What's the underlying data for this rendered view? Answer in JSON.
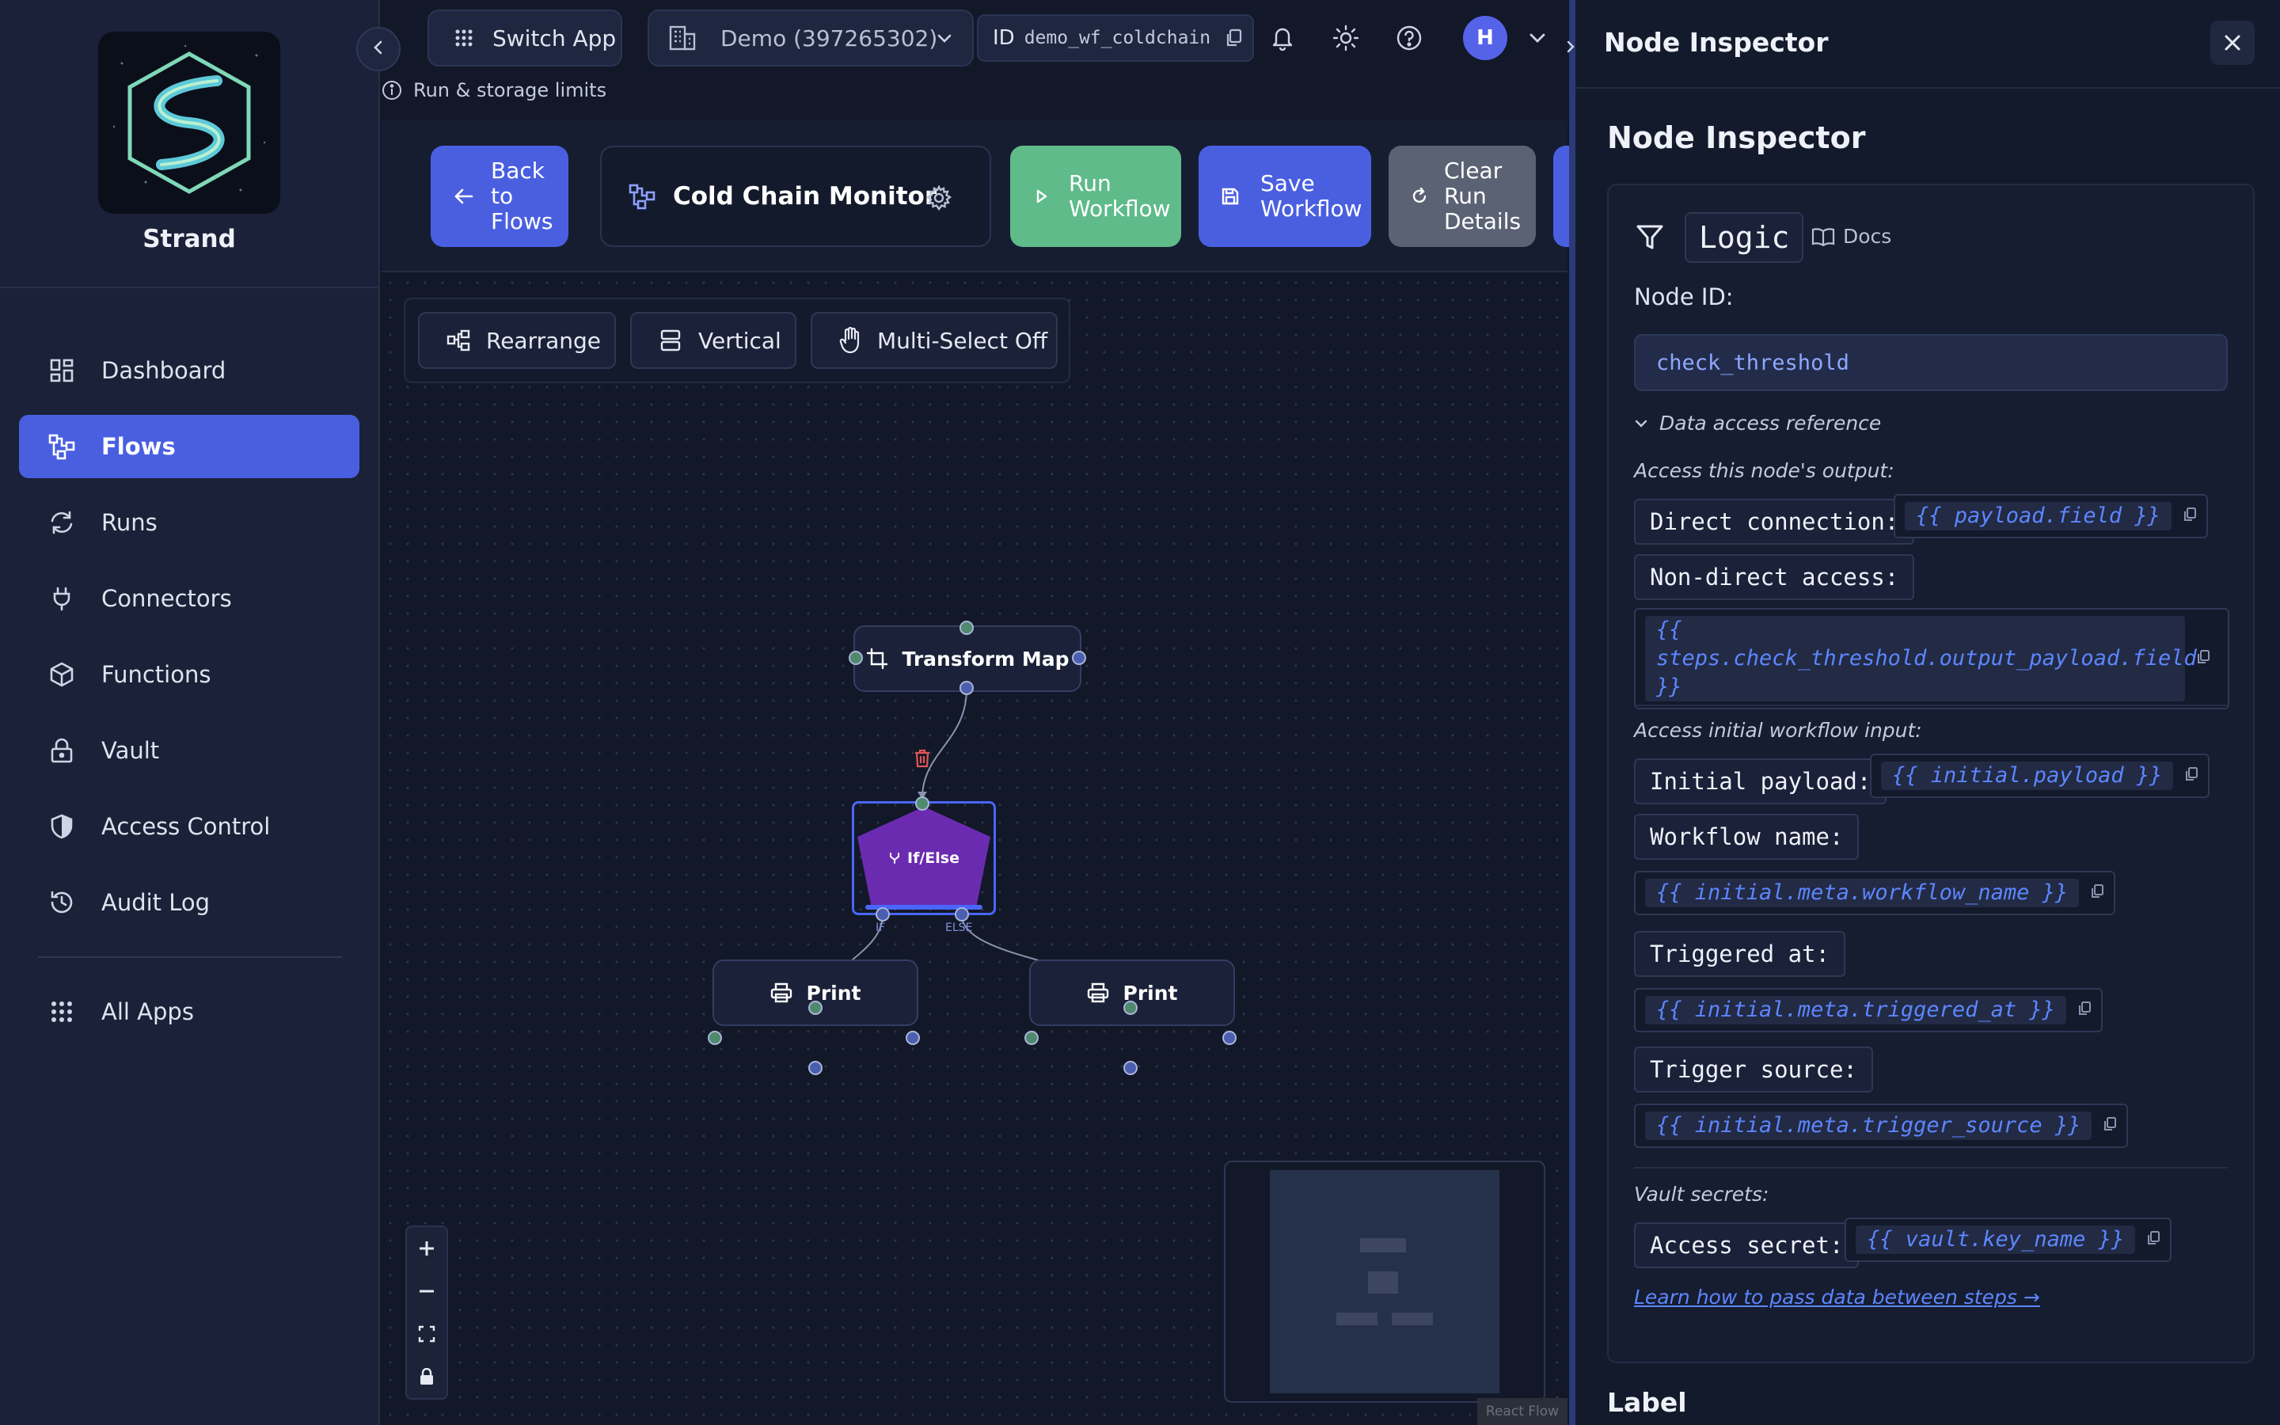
{
  "brand": {
    "name": "Strand"
  },
  "nav": {
    "items": [
      {
        "label": "Dashboard",
        "icon": "dashboard-icon"
      },
      {
        "label": "Flows",
        "icon": "flows-icon",
        "active": true
      },
      {
        "label": "Runs",
        "icon": "runs-icon"
      },
      {
        "label": "Connectors",
        "icon": "plug-icon"
      },
      {
        "label": "Functions",
        "icon": "cube-icon"
      },
      {
        "label": "Vault",
        "icon": "lock-icon"
      },
      {
        "label": "Access Control",
        "icon": "shield-icon"
      },
      {
        "label": "Audit Log",
        "icon": "history-icon"
      }
    ],
    "all_apps": "All Apps"
  },
  "topbar": {
    "switch_app": "Switch App",
    "org": "Demo (397265302)",
    "id_prefix": "ID",
    "workflow_id": "demo_wf_coldchain",
    "avatar_initial": "H",
    "limits": "Run & storage limits"
  },
  "toolbar": {
    "back": [
      "Back",
      "to",
      "Flows"
    ],
    "flow_title": "Cold Chain Monitor",
    "run": [
      "Run",
      "Workflow"
    ],
    "save": [
      "Save",
      "Workflow"
    ],
    "clear": [
      "Clear",
      "Run",
      "Details"
    ]
  },
  "canvas": {
    "rearrange": "Rearrange",
    "vertical": "Vertical",
    "multiselect": "Multi-Select Off",
    "watermark": "React Flow",
    "nodes": {
      "transform": "Transform Map",
      "ifelse": "If/Else",
      "if_label": "IF",
      "else_label": "ELSE",
      "print1": "Print",
      "print2": "Print"
    }
  },
  "inspector": {
    "header": "Node Inspector",
    "title": "Node Inspector",
    "node_type": "Logic",
    "docs": "Docs",
    "node_id_label": "Node ID:",
    "node_id_value": "check_threshold",
    "data_ref_toggle": "Data access reference",
    "section_output": "Access this node's output:",
    "direct_label": "Direct connection:",
    "direct_code": "{{ payload.field }}",
    "nondirect_label": "Non-direct access:",
    "nondirect_code": "{{ steps.check_threshold.output_payload.field }}",
    "section_initial": "Access initial workflow input:",
    "initial_payload_label": "Initial payload:",
    "initial_payload_code": "{{ initial.payload }}",
    "workflow_name_label": "Workflow name:",
    "workflow_name_code": "{{ initial.meta.workflow_name }}",
    "triggered_at_label": "Triggered at:",
    "triggered_at_code": "{{ initial.meta.triggered_at }}",
    "trigger_source_label": "Trigger source:",
    "trigger_source_code": "{{ initial.meta.trigger_source }}",
    "section_vault": "Vault secrets:",
    "secret_label": "Access secret:",
    "secret_code": "{{ vault.key_name }}",
    "learn_link": "Learn how to pass data between steps →",
    "label_heading": "Label"
  },
  "colors": {
    "accent": "#4a5fe0",
    "run_green": "#5fbb8a",
    "ifelse_purple": "#6b2bb0",
    "code_blue": "#5d86ff"
  }
}
